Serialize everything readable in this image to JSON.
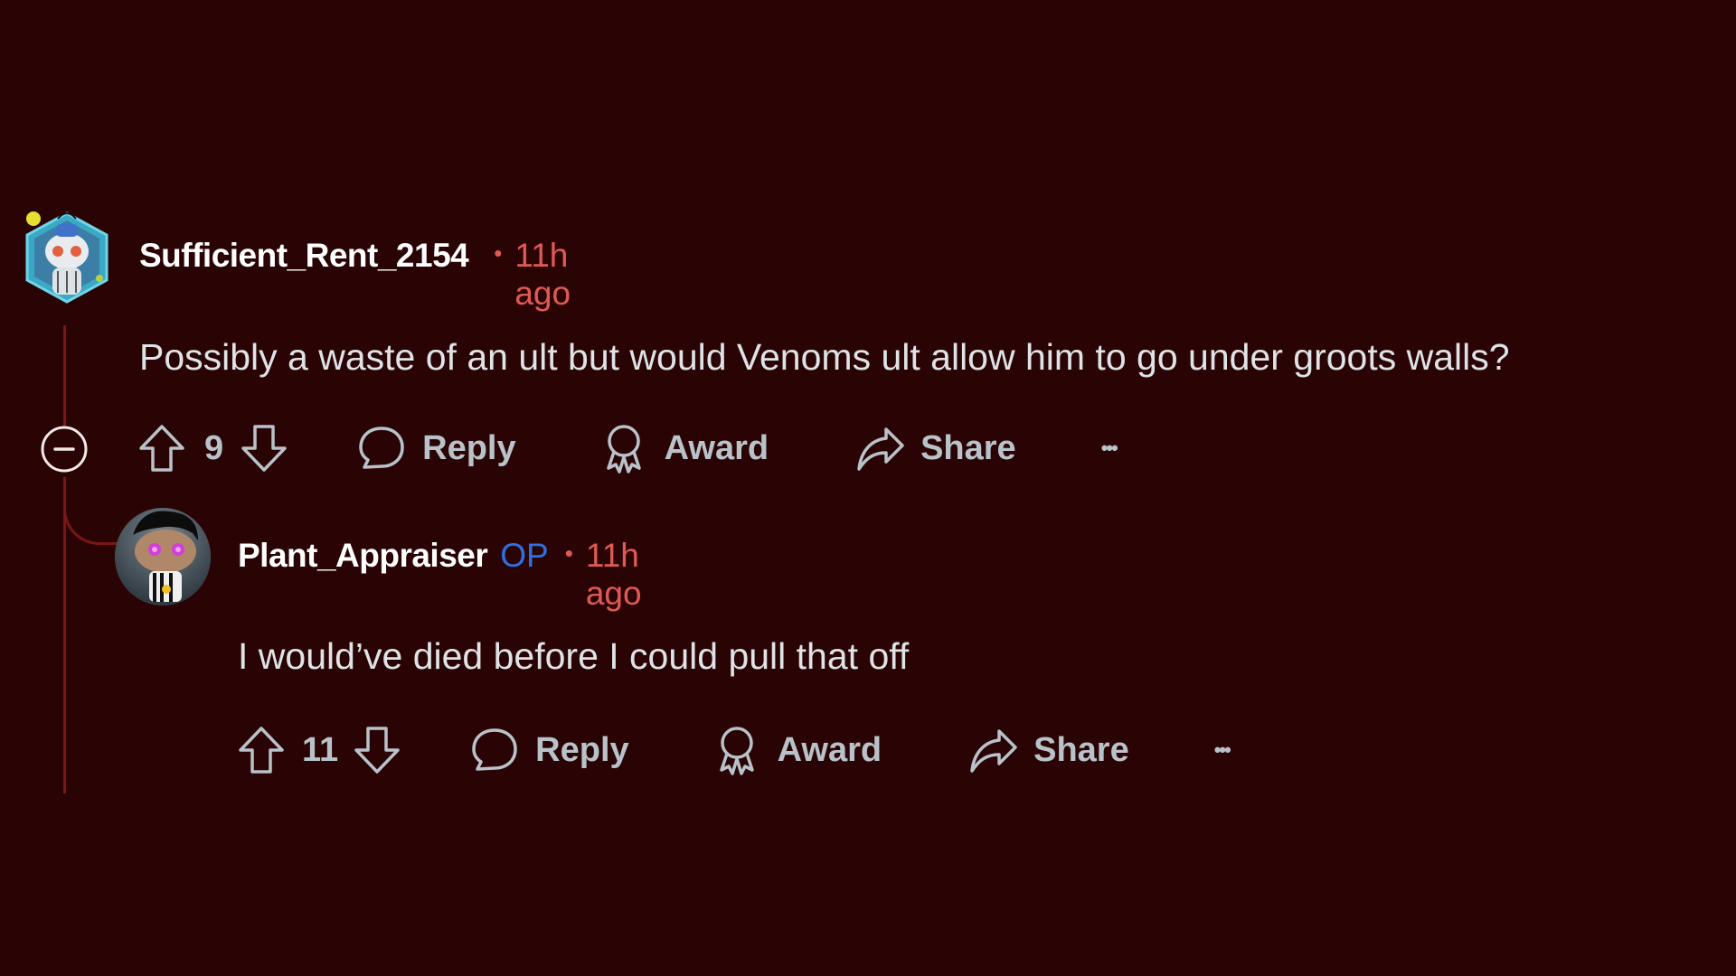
{
  "comments": [
    {
      "username": "Sufficient_Rent_2154",
      "separator": "•",
      "time": "11h ago",
      "body": "Possibly a waste of an ult but would Venoms ult allow him to go under groots walls?",
      "score": "9",
      "actions": {
        "reply": "Reply",
        "award": "Award",
        "share": "Share",
        "more": "•••"
      },
      "avatar_icon": "snoo-robot-avatar"
    },
    {
      "username": "Plant_Appraiser",
      "badge": "OP",
      "separator": "•",
      "time": "11h ago",
      "body": "I would’ve died before I could pull that off",
      "score": "11",
      "actions": {
        "reply": "Reply",
        "award": "Award",
        "share": "Share",
        "more": "•••"
      },
      "avatar_icon": "snoo-character-avatar"
    }
  ],
  "colors": {
    "background": "#2a0405",
    "thread_line": "#7a1616",
    "time": "#e05a55",
    "op_badge": "#2f6fe0",
    "action_text": "#b9c2c8"
  }
}
